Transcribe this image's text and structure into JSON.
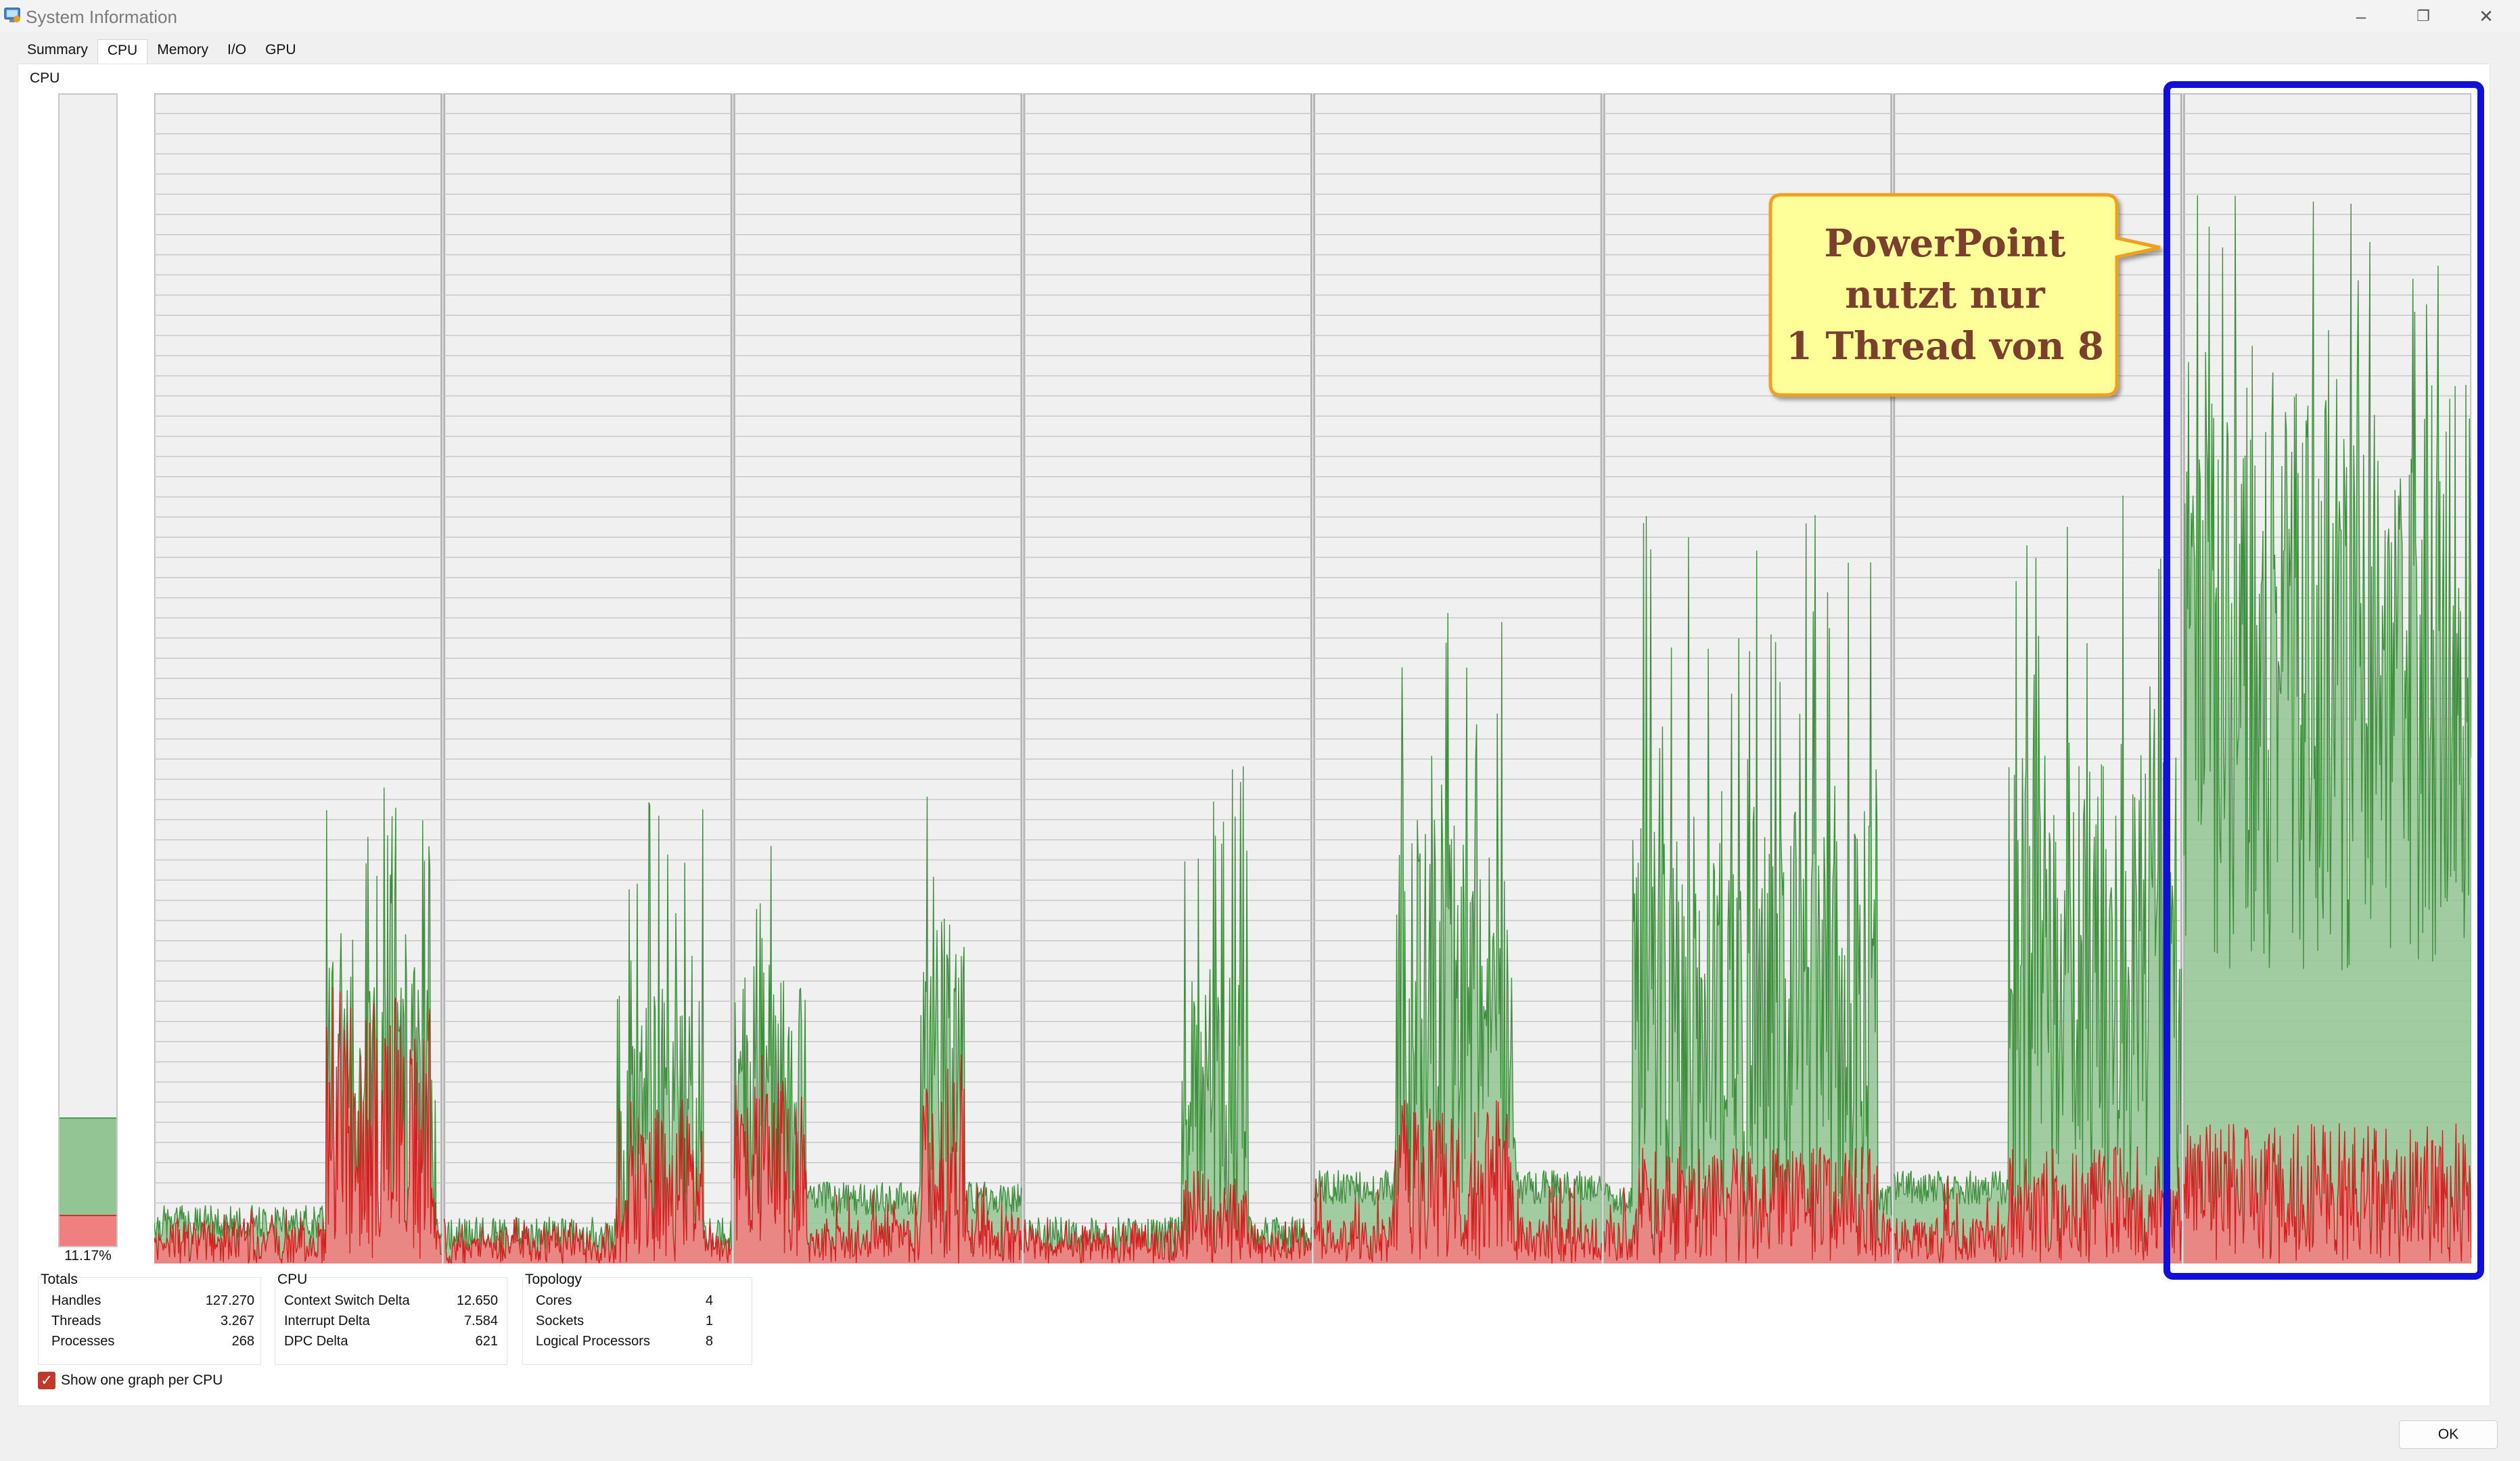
{
  "window": {
    "title": "System Information",
    "icon": "system-information-app-icon",
    "controls": {
      "minimize": "–",
      "restore": "❐",
      "close": "✕"
    }
  },
  "tabs": [
    {
      "label": "Summary",
      "active": false
    },
    {
      "label": "CPU",
      "active": true
    },
    {
      "label": "Memory",
      "active": false
    },
    {
      "label": "I/O",
      "active": false
    },
    {
      "label": "GPU",
      "active": false
    }
  ],
  "gauge": {
    "label": "CPU",
    "percent_text": "11.17%",
    "total_fraction": 0.1117,
    "kernel_fraction": 0.027
  },
  "colors": {
    "user_fill": "#93c493",
    "user_line": "#3f8f3f",
    "kernel_fill": "#f08080",
    "kernel_line": "#d02020",
    "highlight": "#1010d8",
    "callout_fill": "#ffff99",
    "callout_border": "#f0a020",
    "callout_text": "#7b3f2e"
  },
  "chart_data": {
    "type": "area",
    "series_per_cpu": 8,
    "ylim": [
      0,
      100
    ],
    "cpus": [
      {
        "user_baseline": 2,
        "user_peak": 42,
        "kernel_peak": 25,
        "burst_regions": [
          [
            0.6,
            0.98
          ]
        ]
      },
      {
        "user_baseline": 1,
        "user_peak": 40,
        "kernel_peak": 14,
        "burst_regions": [
          [
            0.6,
            0.9
          ]
        ]
      },
      {
        "user_baseline": 4,
        "user_peak": 41,
        "kernel_peak": 18,
        "burst_regions": [
          [
            0.0,
            0.25
          ],
          [
            0.65,
            0.8
          ]
        ]
      },
      {
        "user_baseline": 1,
        "user_peak": 44,
        "kernel_peak": 8,
        "burst_regions": [
          [
            0.55,
            0.78
          ]
        ]
      },
      {
        "user_baseline": 5,
        "user_peak": 60,
        "kernel_peak": 14,
        "burst_regions": [
          [
            0.28,
            0.7
          ]
        ]
      },
      {
        "user_baseline": 4,
        "user_peak": 64,
        "kernel_peak": 10,
        "burst_regions": [
          [
            0.1,
            0.95
          ]
        ]
      },
      {
        "user_baseline": 5,
        "user_peak": 72,
        "kernel_peak": 10,
        "burst_regions": [
          [
            0.4,
            1.0
          ]
        ]
      },
      {
        "user_baseline": 25,
        "user_peak": 92,
        "kernel_peak": 12,
        "burst_regions": [
          [
            0.0,
            1.0
          ]
        ]
      }
    ]
  },
  "callout": {
    "lines": [
      "PowerPoint",
      "nutzt nur",
      "1 Thread von 8"
    ]
  },
  "totals": {
    "title": "Totals",
    "rows": [
      {
        "label": "Handles",
        "value": "127.270"
      },
      {
        "label": "Threads",
        "value": "3.267"
      },
      {
        "label": "Processes",
        "value": "268"
      }
    ]
  },
  "cpu_stats": {
    "title": "CPU",
    "rows": [
      {
        "label": "Context Switch Delta",
        "value": "12.650"
      },
      {
        "label": "Interrupt Delta",
        "value": "7.584"
      },
      {
        "label": "DPC Delta",
        "value": "621"
      }
    ]
  },
  "topology": {
    "title": "Topology",
    "rows": [
      {
        "label": "Cores",
        "value": "4"
      },
      {
        "label": "Sockets",
        "value": "1"
      },
      {
        "label": "Logical Processors",
        "value": "8"
      }
    ]
  },
  "options": {
    "one_graph_per_cpu_label": "Show one graph per CPU",
    "one_graph_per_cpu_checked": true
  },
  "buttons": {
    "ok": "OK"
  }
}
